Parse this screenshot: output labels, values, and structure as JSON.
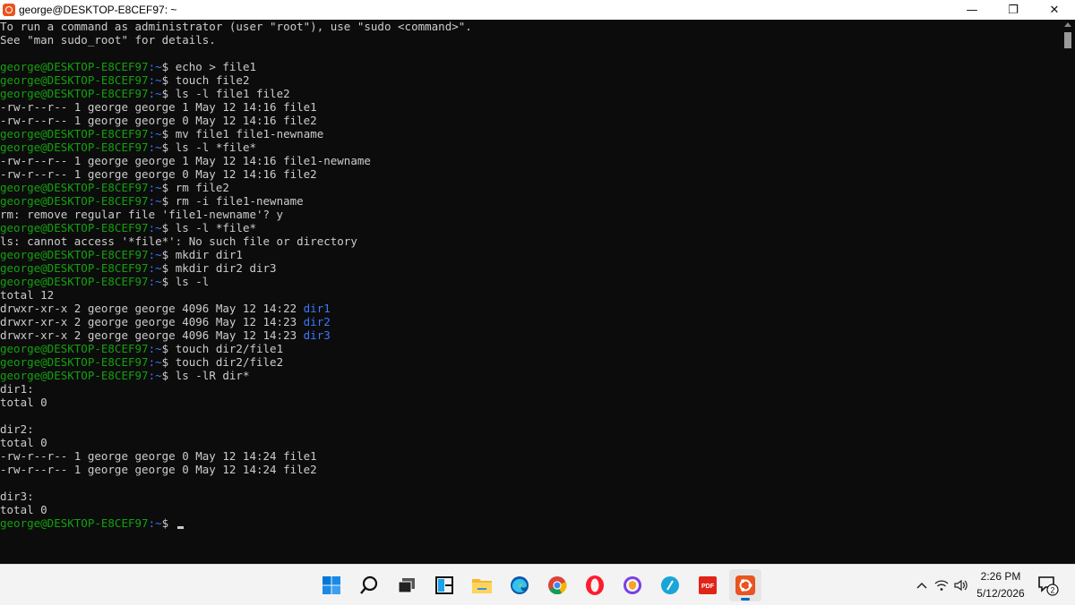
{
  "window": {
    "title": "george@DESKTOP-E8CEF97: ~",
    "minimize": "—",
    "maximize": "❐",
    "close": "✕"
  },
  "terminal": {
    "prompt_user": "george@DESKTOP-E8CEF97",
    "prompt_path": ":~",
    "prompt_symbol": "$ ",
    "lines": [
      {
        "type": "out",
        "text": "To run a command as administrator (user \"root\"), use \"sudo <command>\"."
      },
      {
        "type": "out",
        "text": "See \"man sudo_root\" for details."
      },
      {
        "type": "out",
        "text": ""
      },
      {
        "type": "cmd",
        "text": "echo > file1"
      },
      {
        "type": "cmd",
        "text": "touch file2"
      },
      {
        "type": "cmd",
        "text": "ls -l file1 file2"
      },
      {
        "type": "out",
        "text": "-rw-r--r-- 1 george george 1 May 12 14:16 file1"
      },
      {
        "type": "out",
        "text": "-rw-r--r-- 1 george george 0 May 12 14:16 file2"
      },
      {
        "type": "cmd",
        "text": "mv file1 file1-newname"
      },
      {
        "type": "cmd",
        "text": "ls -l *file*"
      },
      {
        "type": "out",
        "text": "-rw-r--r-- 1 george george 1 May 12 14:16 file1-newname"
      },
      {
        "type": "out",
        "text": "-rw-r--r-- 1 george george 0 May 12 14:16 file2"
      },
      {
        "type": "cmd",
        "text": "rm file2"
      },
      {
        "type": "cmd",
        "text": "rm -i file1-newname"
      },
      {
        "type": "out",
        "text": "rm: remove regular file 'file1-newname'? y"
      },
      {
        "type": "cmd",
        "text": "ls -l *file*"
      },
      {
        "type": "out",
        "text": "ls: cannot access '*file*': No such file or directory"
      },
      {
        "type": "cmd",
        "text": "mkdir dir1"
      },
      {
        "type": "cmd",
        "text": "mkdir dir2 dir3"
      },
      {
        "type": "cmd",
        "text": "ls -l"
      },
      {
        "type": "out",
        "text": "total 12"
      },
      {
        "type": "dir",
        "text": "drwxr-xr-x 2 george george 4096 May 12 14:22 ",
        "name": "dir1"
      },
      {
        "type": "dir",
        "text": "drwxr-xr-x 2 george george 4096 May 12 14:23 ",
        "name": "dir2"
      },
      {
        "type": "dir",
        "text": "drwxr-xr-x 2 george george 4096 May 12 14:23 ",
        "name": "dir3"
      },
      {
        "type": "cmd",
        "text": "touch dir2/file1"
      },
      {
        "type": "cmd",
        "text": "touch dir2/file2"
      },
      {
        "type": "cmd",
        "text": "ls -lR dir*"
      },
      {
        "type": "out",
        "text": "dir1:"
      },
      {
        "type": "out",
        "text": "total 0"
      },
      {
        "type": "out",
        "text": ""
      },
      {
        "type": "out",
        "text": "dir2:"
      },
      {
        "type": "out",
        "text": "total 0"
      },
      {
        "type": "out",
        "text": "-rw-r--r-- 1 george george 0 May 12 14:24 file1"
      },
      {
        "type": "out",
        "text": "-rw-r--r-- 1 george george 0 May 12 14:24 file2"
      },
      {
        "type": "out",
        "text": ""
      },
      {
        "type": "out",
        "text": "dir3:"
      },
      {
        "type": "out",
        "text": "total 0"
      },
      {
        "type": "prompt",
        "text": ""
      }
    ]
  },
  "taskbar": {
    "apps": [
      {
        "name": "start",
        "icon": "windows-icon"
      },
      {
        "name": "search",
        "icon": "search-icon"
      },
      {
        "name": "task-view",
        "icon": "task-view-icon"
      },
      {
        "name": "widgets",
        "icon": "widgets-icon"
      },
      {
        "name": "file-explorer",
        "icon": "folder-icon"
      },
      {
        "name": "edge",
        "icon": "edge-icon"
      },
      {
        "name": "chrome",
        "icon": "chrome-icon"
      },
      {
        "name": "opera",
        "icon": "opera-icon"
      },
      {
        "name": "vpn",
        "icon": "shield-icon"
      },
      {
        "name": "pen",
        "icon": "pen-icon"
      },
      {
        "name": "pdf",
        "icon": "pdf-icon"
      },
      {
        "name": "ubuntu",
        "icon": "ubuntu-icon",
        "active": true
      }
    ],
    "pdf_label": "PDF",
    "time": "2:26 PM",
    "date": "5/12/2026",
    "notification_count": "2",
    "colors": {
      "accent": "#0067c0",
      "ubuntu": "#e95420",
      "opera": "#ff1b2d",
      "edge": "#0c59a4",
      "pdf": "#e2231a"
    }
  }
}
